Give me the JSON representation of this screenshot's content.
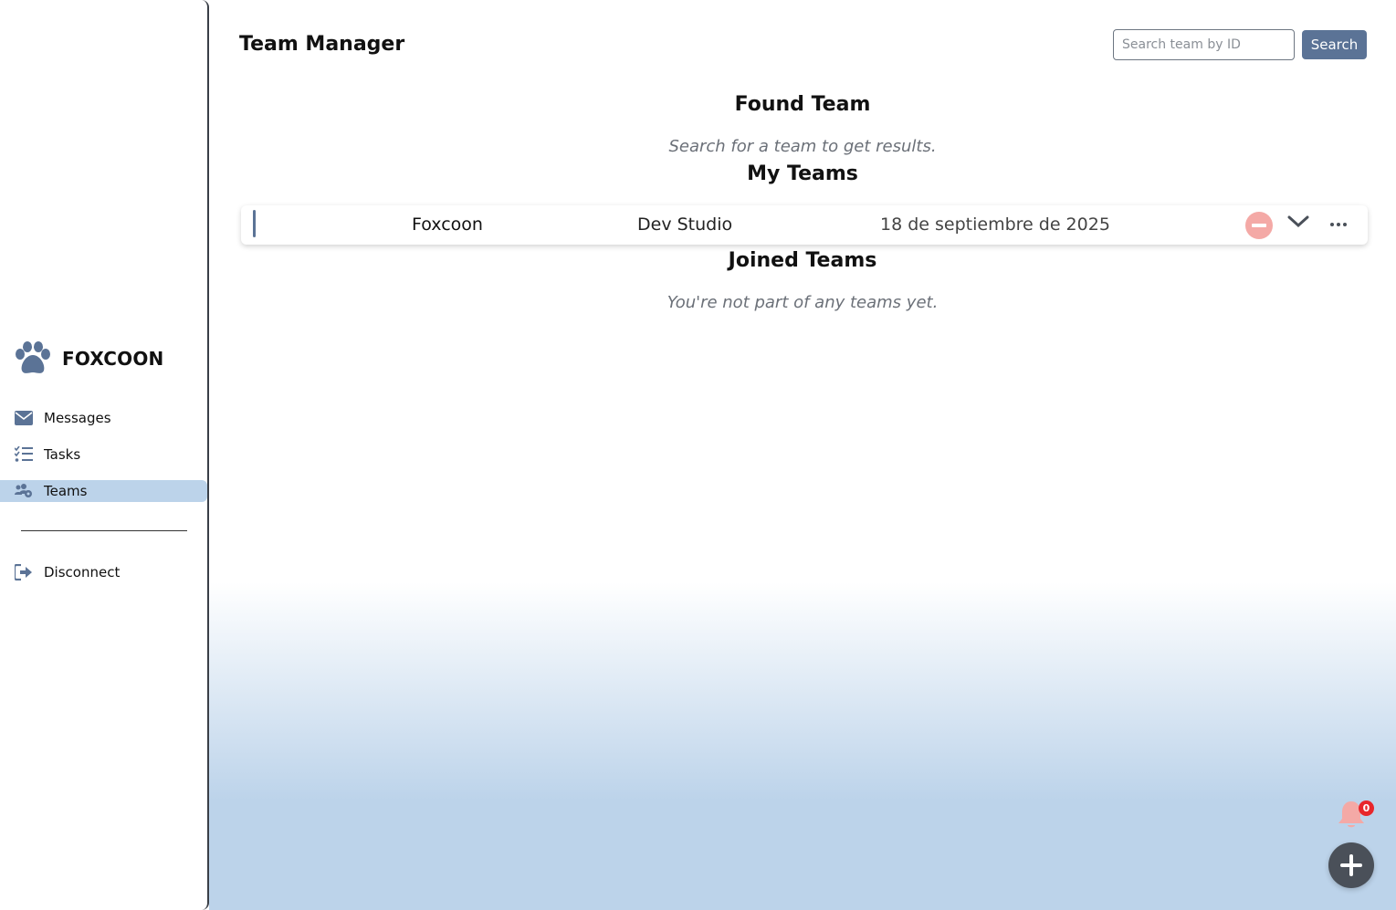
{
  "brand": {
    "name": "FOXCOON",
    "icon": "paw-icon"
  },
  "sidebar": {
    "items": [
      {
        "label": "Messages",
        "icon": "envelope-icon",
        "active": false
      },
      {
        "label": "Tasks",
        "icon": "task-list-icon",
        "active": false
      },
      {
        "label": "Teams",
        "icon": "users-gear-icon",
        "active": true
      }
    ],
    "disconnect": {
      "label": "Disconnect",
      "icon": "sign-out-icon"
    }
  },
  "header": {
    "title": "Team Manager",
    "search": {
      "placeholder": "Search team by ID",
      "value": "",
      "button_label": "Search"
    }
  },
  "found_team": {
    "title": "Found Team",
    "empty_message": "Search for a team to get results."
  },
  "my_teams": {
    "title": "My Teams",
    "rows": [
      {
        "name": "Foxcoon",
        "organization": "Dev Studio",
        "date": "18 de septiembre de 2025"
      }
    ]
  },
  "joined_teams": {
    "title": "Joined Teams",
    "empty_message": "You're not part of any teams yet."
  },
  "notifications": {
    "count": "0"
  },
  "colors": {
    "accent": "#5b7396",
    "active_nav": "#bcd3ea",
    "leave": "#f4a9a6",
    "badge": "#e8262b",
    "fab": "#4a5059"
  }
}
